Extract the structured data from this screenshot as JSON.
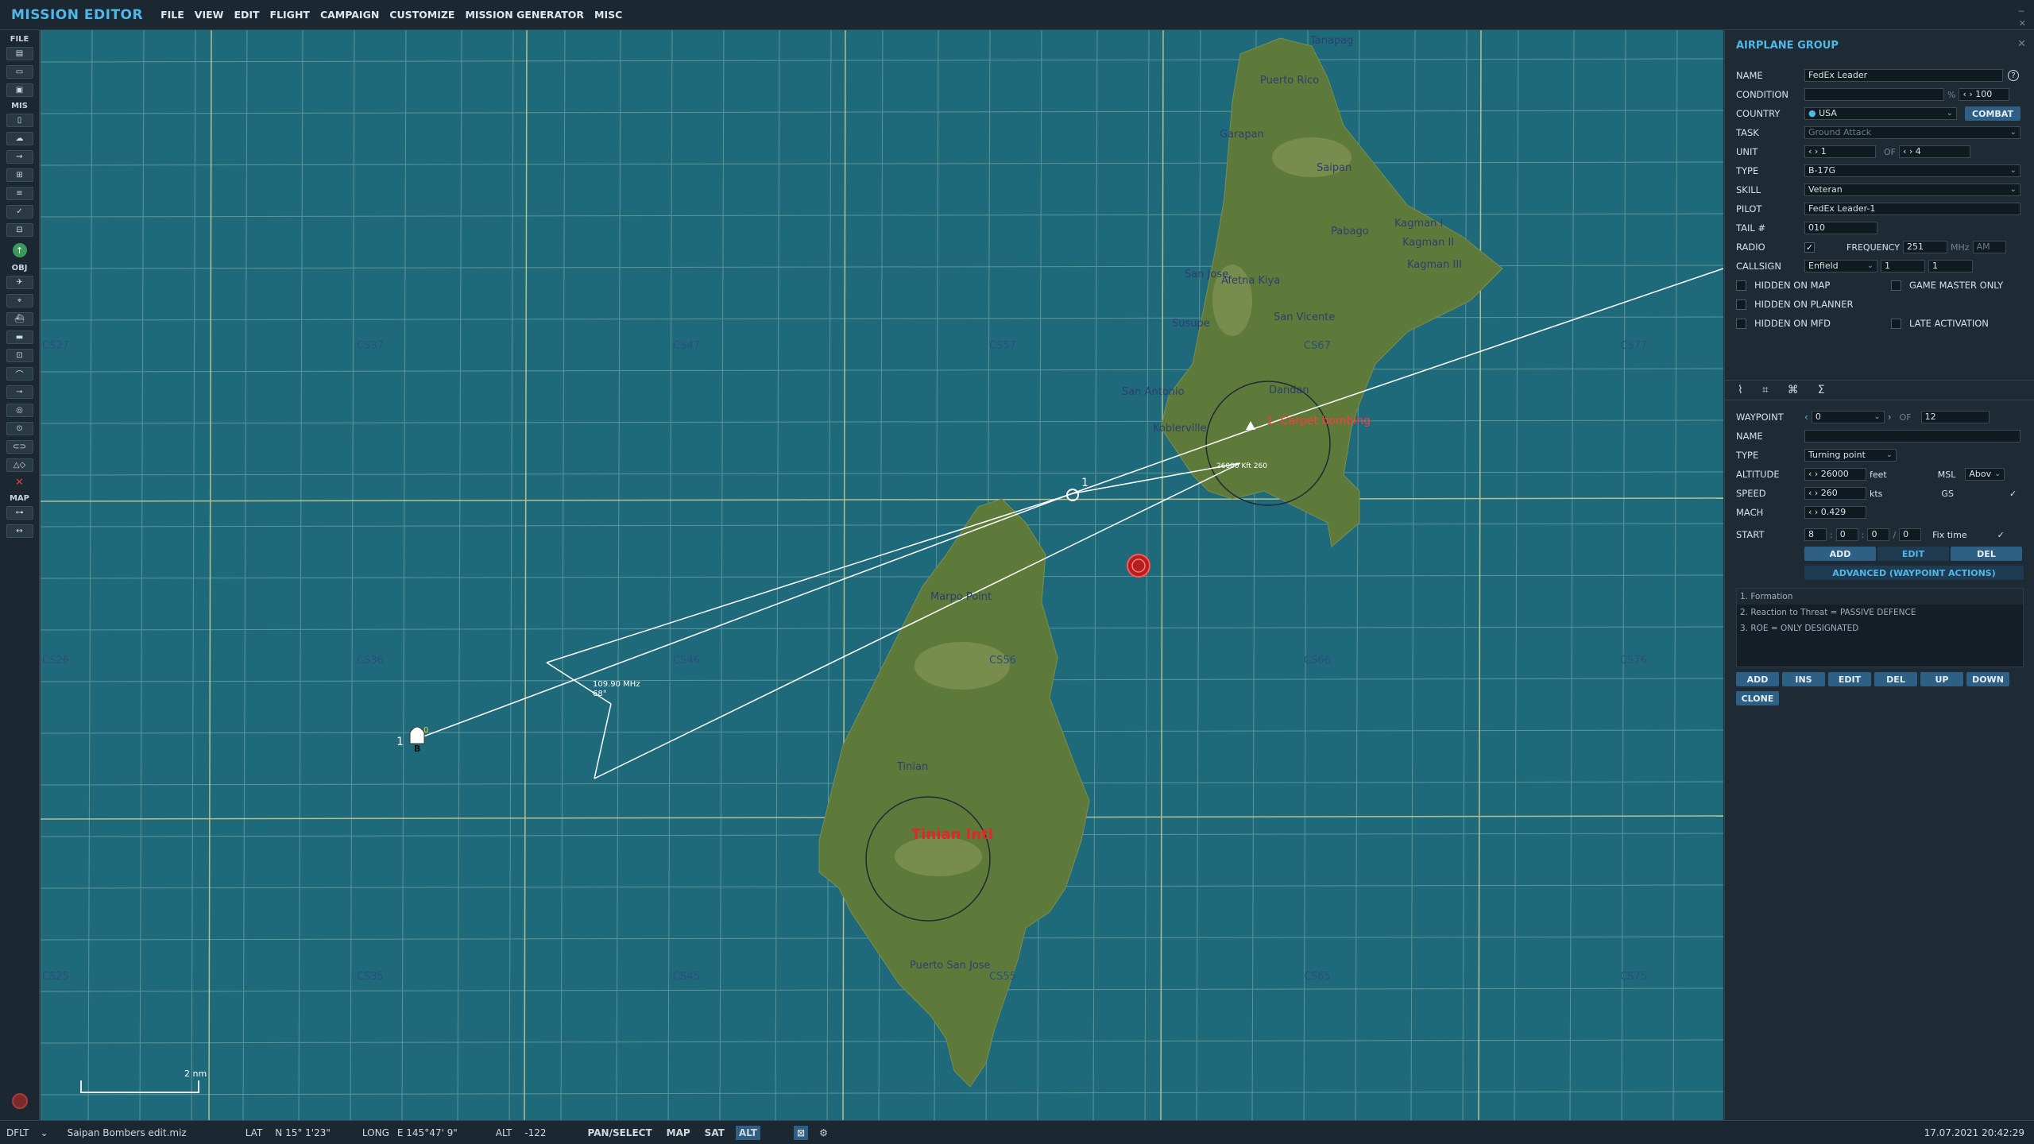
{
  "app": {
    "title": "MISSION EDITOR",
    "menu": [
      "FILE",
      "VIEW",
      "EDIT",
      "FLIGHT",
      "CAMPAIGN",
      "CUSTOMIZE",
      "MISSION GENERATOR",
      "MISC"
    ]
  },
  "toolbar": {
    "sections": [
      "FILE",
      "MIS",
      "OBJ",
      "MAP"
    ]
  },
  "map": {
    "grid_labels": [
      "CS27",
      "CS37",
      "CS47",
      "CS57",
      "CS67",
      "CS77",
      "CS26",
      "CS36",
      "CS46",
      "CS56",
      "CS66",
      "CS76",
      "CS25",
      "CS35",
      "CS45",
      "CS55",
      "CS65",
      "CS75"
    ],
    "places": [
      "Tanapag",
      "Puerto Rico",
      "Garapan",
      "Saipan",
      "Pabago",
      "Kagman I",
      "Kagman II",
      "Kagman III",
      "San Jose",
      "Afetna Kiya",
      "Susupe",
      "San Vicente",
      "San Antonio",
      "Dandan",
      "Koblerville",
      "Marpo Point",
      "Tinian",
      "Puerto San Jose"
    ],
    "airfield": "Tinian Intl",
    "waypoint_target": "1. Carpet bombing",
    "waypoint_number": "1",
    "start_number": "1",
    "start_sub": "0",
    "start_marker": "B",
    "beacon_freq": "109.90 MHz",
    "beacon_bearing": "68°",
    "wp_alt_label": "26000 Kft 260",
    "scale": "2 nm"
  },
  "panel": {
    "title": "AIRPLANE GROUP",
    "name": {
      "label": "NAME",
      "value": "FedEx Leader"
    },
    "condition": {
      "label": "CONDITION",
      "pct": "%",
      "value": "100"
    },
    "country": {
      "label": "COUNTRY",
      "value": "USA",
      "combat": "COMBAT"
    },
    "task": {
      "label": "TASK",
      "value": "Ground Attack"
    },
    "unit": {
      "label": "UNIT",
      "value": "1",
      "of": "OF",
      "total": "4"
    },
    "type": {
      "label": "TYPE",
      "value": "B-17G"
    },
    "skill": {
      "label": "SKILL",
      "value": "Veteran"
    },
    "pilot": {
      "label": "PILOT",
      "value": "FedEx Leader-1"
    },
    "tail": {
      "label": "TAIL #",
      "value": "010"
    },
    "radio": {
      "label": "RADIO",
      "freq_label": "FREQUENCY",
      "freq": "251",
      "mhz": "MHz",
      "band": "AM"
    },
    "callsign": {
      "label": "CALLSIGN",
      "value": "Enfield",
      "n1": "1",
      "n2": "1"
    },
    "checks": {
      "hidden_map": "HIDDEN ON MAP",
      "gm_only": "GAME MASTER ONLY",
      "hidden_planner": "HIDDEN ON PLANNER",
      "hidden_mfd": "HIDDEN ON MFD",
      "late": "LATE ACTIVATION"
    },
    "waypoint": {
      "label": "WAYPOINT",
      "value": "0",
      "of": "OF",
      "total": "12",
      "name_label": "NAME",
      "name_value": "",
      "type_label": "TYPE",
      "type_value": "Turning point",
      "alt_label": "ALTITUDE",
      "alt": "26000",
      "alt_unit": "feet",
      "alt_ref": "MSL",
      "alt_mode": "Abov",
      "speed_label": "SPEED",
      "speed": "260",
      "speed_unit": "kts",
      "gs": "GS",
      "mach_label": "MACH",
      "mach": "0.429",
      "start_label": "START",
      "h": "8",
      "m": "0",
      "s": "0",
      "d": "0",
      "fix": "Fix time",
      "add": "ADD",
      "edit": "EDIT",
      "del": "DEL",
      "advanced": "ADVANCED (WAYPOINT ACTIONS)"
    },
    "actions": [
      "1. Formation",
      "2. Reaction to Threat = PASSIVE DEFENCE",
      "3. ROE = ONLY DESIGNATED"
    ],
    "action_buttons": [
      "ADD",
      "INS",
      "EDIT",
      "DEL",
      "UP",
      "DOWN"
    ],
    "clone": "CLONE"
  },
  "status": {
    "profile": "DFLT",
    "file": "Saipan Bombers edit.miz",
    "lat_label": "LAT",
    "lat": "N 15° 1'23\"",
    "long_label": "LONG",
    "long": "E 145°47' 9\"",
    "alt_label": "ALT",
    "alt": "-122",
    "pan": "PAN/SELECT",
    "map": "MAP",
    "sat": "SAT",
    "alt_btn": "ALT",
    "datetime": "17.07.2021 20:42:29"
  }
}
